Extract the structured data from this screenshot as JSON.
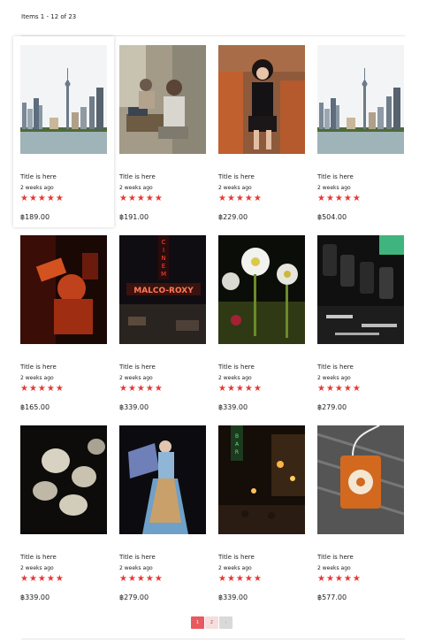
{
  "toolbar": {
    "items_label": "Items 1 - 12 of 23"
  },
  "products": [
    {
      "title": "Title is here",
      "date": "2 weeks ago",
      "rating": 5,
      "stars": "★★★★★",
      "price": "฿189.00",
      "image": "city-skyline"
    },
    {
      "title": "Title is here",
      "date": "2 weeks ago",
      "rating": 5,
      "stars": "★★★★★",
      "price": "฿191.00",
      "image": "street-vendor"
    },
    {
      "title": "Title is here",
      "date": "2 weeks ago",
      "rating": 5,
      "stars": "★★★★★",
      "price": "฿229.00",
      "image": "woman-on-chair"
    },
    {
      "title": "Title is here",
      "date": "2 weeks ago",
      "rating": 5,
      "stars": "★★★★★",
      "price": "฿504.00",
      "image": "city-skyline"
    },
    {
      "title": "Title is here",
      "date": "2 weeks ago",
      "rating": 5,
      "stars": "★★★★★",
      "price": "฿165.00",
      "image": "red-portrait"
    },
    {
      "title": "Title is here",
      "date": "2 weeks ago",
      "rating": 5,
      "stars": "★★★★★",
      "price": "฿339.00",
      "image": "cinema-sign"
    },
    {
      "title": "Title is here",
      "date": "2 weeks ago",
      "rating": 5,
      "stars": "★★★★★",
      "price": "฿339.00",
      "image": "white-flowers"
    },
    {
      "title": "Title is here",
      "date": "2 weeks ago",
      "rating": 5,
      "stars": "★★★★★",
      "price": "฿279.00",
      "image": "circuit-board"
    },
    {
      "title": "Title is here",
      "date": "2 weeks ago",
      "rating": 5,
      "stars": "★★★★★",
      "price": "฿339.00",
      "image": "garlic"
    },
    {
      "title": "Title is here",
      "date": "2 weeks ago",
      "rating": 5,
      "stars": "★★★★★",
      "price": "฿279.00",
      "image": "fashion-model"
    },
    {
      "title": "Title is here",
      "date": "2 weeks ago",
      "rating": 5,
      "stars": "★★★★★",
      "price": "฿339.00",
      "image": "night-street"
    },
    {
      "title": "Title is here",
      "date": "2 weeks ago",
      "rating": 5,
      "stars": "★★★★★",
      "price": "฿577.00",
      "image": "orange-music-player"
    }
  ],
  "pagination": {
    "pages": [
      "1",
      "2"
    ],
    "current": "1",
    "next": "›"
  },
  "colors": {
    "star": "#e53935",
    "page_active": "#e85a5f",
    "page_inactive": "#f6dede"
  }
}
